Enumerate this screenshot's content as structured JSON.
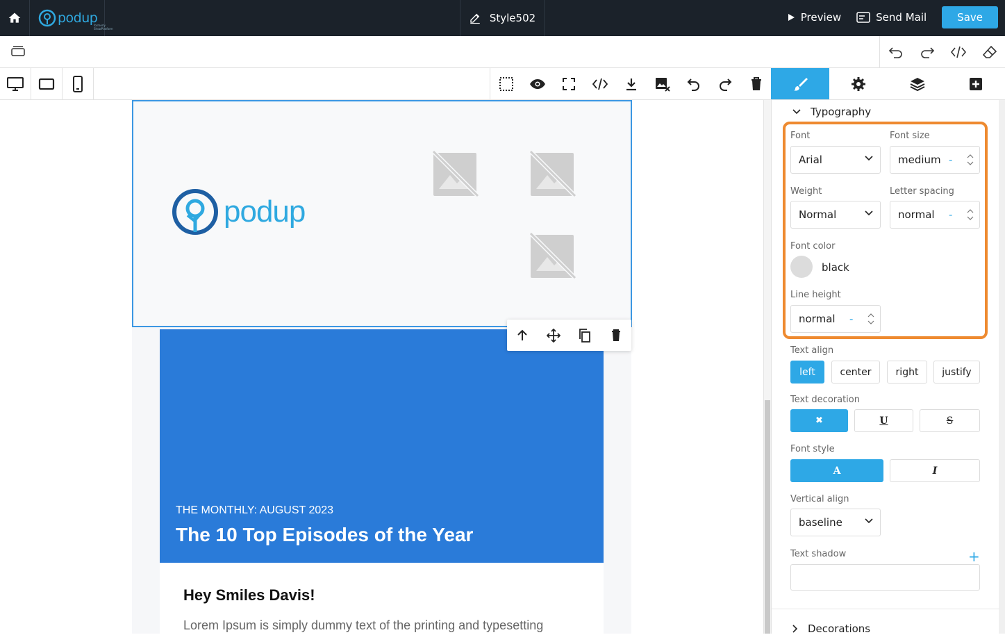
{
  "topbar": {
    "logo_text": "podup",
    "logo_sub": "formerly ShowPlatform",
    "title": "Style502",
    "preview_label": "Preview",
    "sendmail_label": "Send Mail",
    "save_label": "Save"
  },
  "colors": {
    "accent": "#2ea8e6",
    "hero": "#2a7bd9",
    "highlight": "#ee8a30",
    "topbar": "#1b222a"
  },
  "email": {
    "brand": "podup",
    "hero_kicker": "THE MONTHLY: AUGUST 2023",
    "hero_title": "The 10 Top Episodes of the Year",
    "greeting": "Hey Smiles Davis!",
    "lorem": "Lorem Ipsum is simply dummy text of the printing and typesetting"
  },
  "panel": {
    "section_title": "Typography",
    "font_label": "Font",
    "font_value": "Arial",
    "font_size_label": "Font size",
    "font_size_value": "medium",
    "weight_label": "Weight",
    "weight_value": "Normal",
    "letter_spacing_label": "Letter spacing",
    "letter_spacing_value": "normal",
    "font_color_label": "Font color",
    "font_color_value": "black",
    "line_height_label": "Line height",
    "line_height_value": "normal",
    "unit_dash": "-",
    "text_align_label": "Text align",
    "align_left": "left",
    "align_center": "center",
    "align_right": "right",
    "align_justify": "justify",
    "text_decoration_label": "Text decoration",
    "deco_none": "✖",
    "deco_underline": "U",
    "deco_strike": "S",
    "font_style_label": "Font style",
    "style_normal": "A",
    "style_italic": "I",
    "vertical_align_label": "Vertical align",
    "vertical_align_value": "baseline",
    "text_shadow_label": "Text shadow",
    "add_symbol": "+",
    "next_section": "Decorations"
  }
}
